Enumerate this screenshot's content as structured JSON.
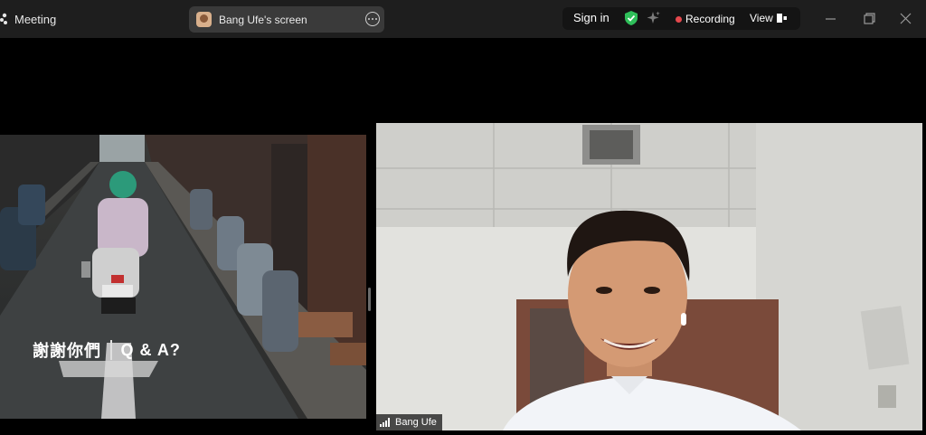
{
  "titlebar": {
    "app_title": "Meeting",
    "share_label": "Bang Ufe's screen",
    "signin_label": "Sign in",
    "recording_label": "Recording",
    "view_label": "View"
  },
  "slide": {
    "caption_left": "謝謝你們",
    "caption_right": "Q & A?"
  },
  "participant": {
    "name": "Bang Ufe"
  },
  "colors": {
    "titlebar_bg": "#1e1e1e",
    "recording_dot": "#e5484d",
    "shield_green": "#2fbf5a"
  },
  "icons": [
    "zoom-meeting-icon",
    "more-options-icon",
    "shield-check-icon",
    "ai-sparkle-icon",
    "view-layout-icon",
    "minimize-icon",
    "maximize-icon",
    "close-icon",
    "signal-strength-icon"
  ]
}
